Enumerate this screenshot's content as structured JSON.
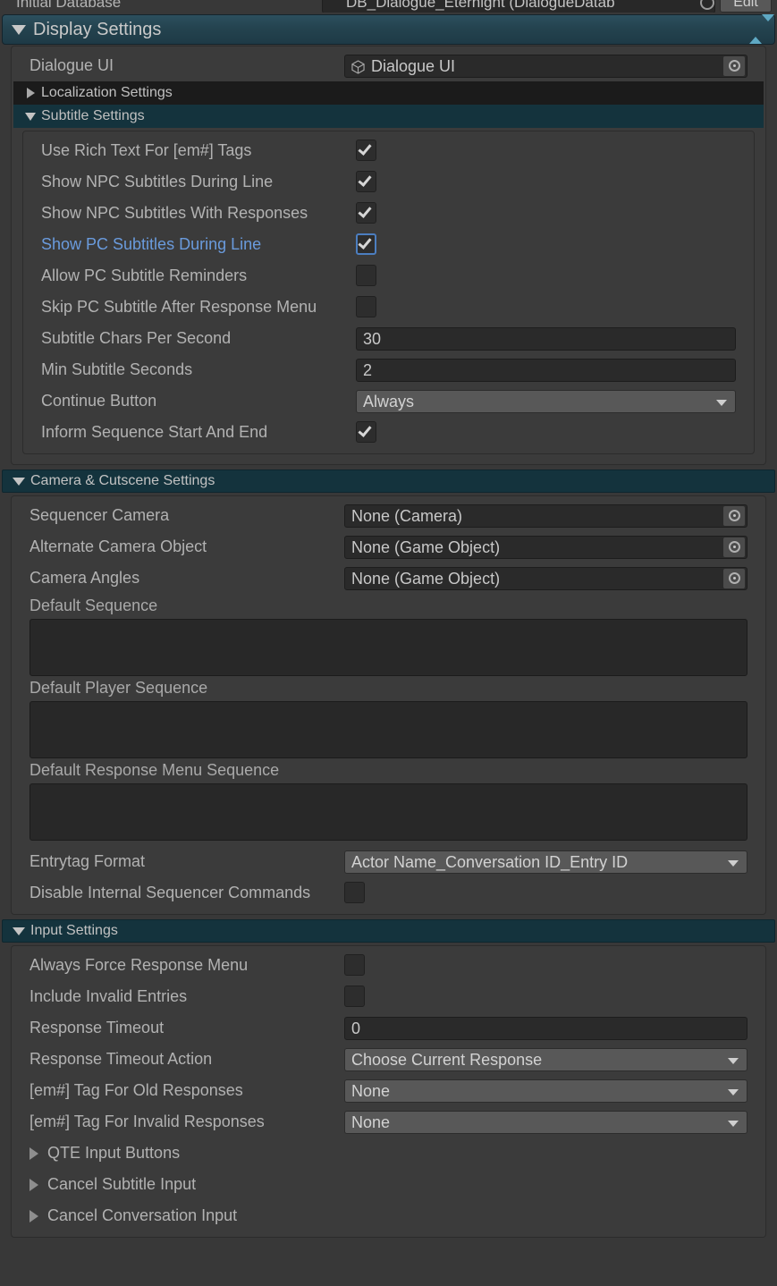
{
  "window": {
    "background": "#383838",
    "accent_teal": "#14333d",
    "highlight_blue": "#6a9bdd"
  },
  "clipped_top_row": {
    "label": "Initial Database",
    "value": "DB_Dialogue_Eternight (DialogueDatab",
    "edit_button": "Edit",
    "flag_icon": "flag-icon",
    "picker_icon": "object-picker-icon"
  },
  "display_settings": {
    "title": "Display Settings",
    "foldout_icon": "triangle-down-icon",
    "reorder_icon": "sort-arrows-icon",
    "dialogue_ui": {
      "label": "Dialogue UI",
      "value": "Dialogue UI",
      "prefab_icon": "prefab-cube-icon",
      "picker_icon": "object-picker-icon"
    },
    "localization_settings": {
      "label": "Localization Settings",
      "foldout_icon": "triangle-right-icon",
      "expanded": false
    },
    "subtitle_settings": {
      "label": "Subtitle Settings",
      "foldout_icon": "triangle-down-icon",
      "expanded": true,
      "rows": [
        {
          "label": "Use Rich Text For [em#] Tags",
          "type": "checkbox",
          "checked": true,
          "focused": false
        },
        {
          "label": "Show NPC Subtitles During Line",
          "type": "checkbox",
          "checked": true,
          "focused": false
        },
        {
          "label": "Show NPC Subtitles With Responses",
          "type": "checkbox",
          "checked": true,
          "focused": false
        },
        {
          "label": "Show PC Subtitles During Line",
          "type": "checkbox",
          "checked": true,
          "focused": true
        },
        {
          "label": "Allow PC Subtitle Reminders",
          "type": "checkbox",
          "checked": false,
          "focused": false
        },
        {
          "label": "Skip PC Subtitle After Response Menu",
          "type": "checkbox",
          "checked": false,
          "focused": false
        },
        {
          "label": "Subtitle Chars Per Second",
          "type": "text",
          "value": "30"
        },
        {
          "label": "Min Subtitle Seconds",
          "type": "text",
          "value": "2"
        },
        {
          "label": "Continue Button",
          "type": "popup",
          "value": "Always"
        },
        {
          "label": "Inform Sequence Start And End",
          "type": "checkbox",
          "checked": true,
          "focused": false
        }
      ]
    }
  },
  "camera_settings": {
    "title": "Camera & Cutscene Settings",
    "foldout_icon": "triangle-down-icon",
    "rows": [
      {
        "label": "Sequencer Camera",
        "type": "objref",
        "value": "None (Camera)"
      },
      {
        "label": "Alternate Camera Object",
        "type": "objref",
        "value": "None (Game Object)"
      },
      {
        "label": "Camera Angles",
        "type": "objref",
        "value": "None (Game Object)"
      },
      {
        "label": "Default Sequence",
        "type": "textarea",
        "value": ""
      },
      {
        "label": "Default Player Sequence",
        "type": "textarea",
        "value": ""
      },
      {
        "label": "Default Response Menu Sequence",
        "type": "textarea",
        "value": ""
      },
      {
        "label": "Entrytag Format",
        "type": "popup",
        "value": "Actor Name_Conversation ID_Entry ID"
      },
      {
        "label": "Disable Internal Sequencer Commands",
        "type": "checkbox",
        "checked": false,
        "focused": false
      }
    ]
  },
  "input_settings": {
    "title": "Input Settings",
    "foldout_icon": "triangle-down-icon",
    "rows": [
      {
        "label": "Always Force Response Menu",
        "type": "checkbox",
        "checked": false,
        "focused": false
      },
      {
        "label": "Include Invalid Entries",
        "type": "checkbox",
        "checked": false,
        "focused": false
      },
      {
        "label": "Response Timeout",
        "type": "text",
        "value": "0"
      },
      {
        "label": "Response Timeout Action",
        "type": "popup",
        "value": "Choose Current Response"
      },
      {
        "label": "[em#] Tag For Old Responses",
        "type": "popup",
        "value": "None"
      },
      {
        "label": "[em#] Tag For Invalid Responses",
        "type": "popup",
        "value": "None"
      },
      {
        "label": "QTE Input Buttons",
        "type": "foldout",
        "foldout_icon": "triangle-right-icon"
      },
      {
        "label": "Cancel Subtitle Input",
        "type": "foldout",
        "foldout_icon": "triangle-right-icon"
      },
      {
        "label": "Cancel Conversation Input",
        "type": "foldout",
        "foldout_icon": "triangle-right-icon"
      }
    ]
  }
}
